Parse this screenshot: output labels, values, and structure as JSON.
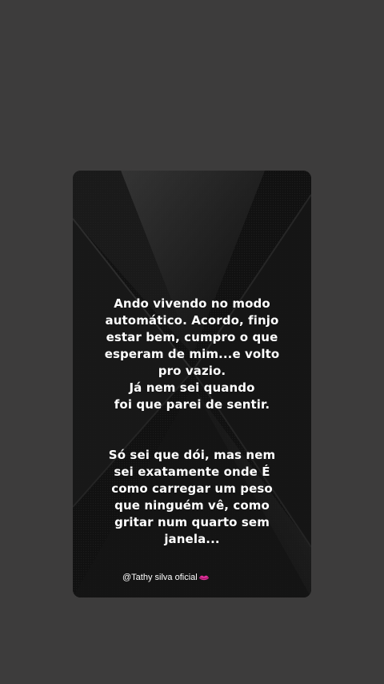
{
  "story": {
    "paragraph_1": "Ando vivendo no modo\nautomático. Acordo, finjo\nestar bem, cumpro o que\nesperam de mim...e volto\npro vazio.\nJá nem sei quando\nfoi que parei de sentir.",
    "paragraph_2": "Só sei que dói, mas nem\nsei exatamente onde É\ncomo carregar um peso\nque ninguém vê, como\ngritar  num quarto sem\njanela...",
    "signature": "@Tathy silva oficial",
    "signature_icon": "lips-icon"
  },
  "colors": {
    "page_background": "#3d3c3c",
    "card_background": "#0e0e0e",
    "text": "#ffffff",
    "icon_accent": "#e0309a"
  }
}
